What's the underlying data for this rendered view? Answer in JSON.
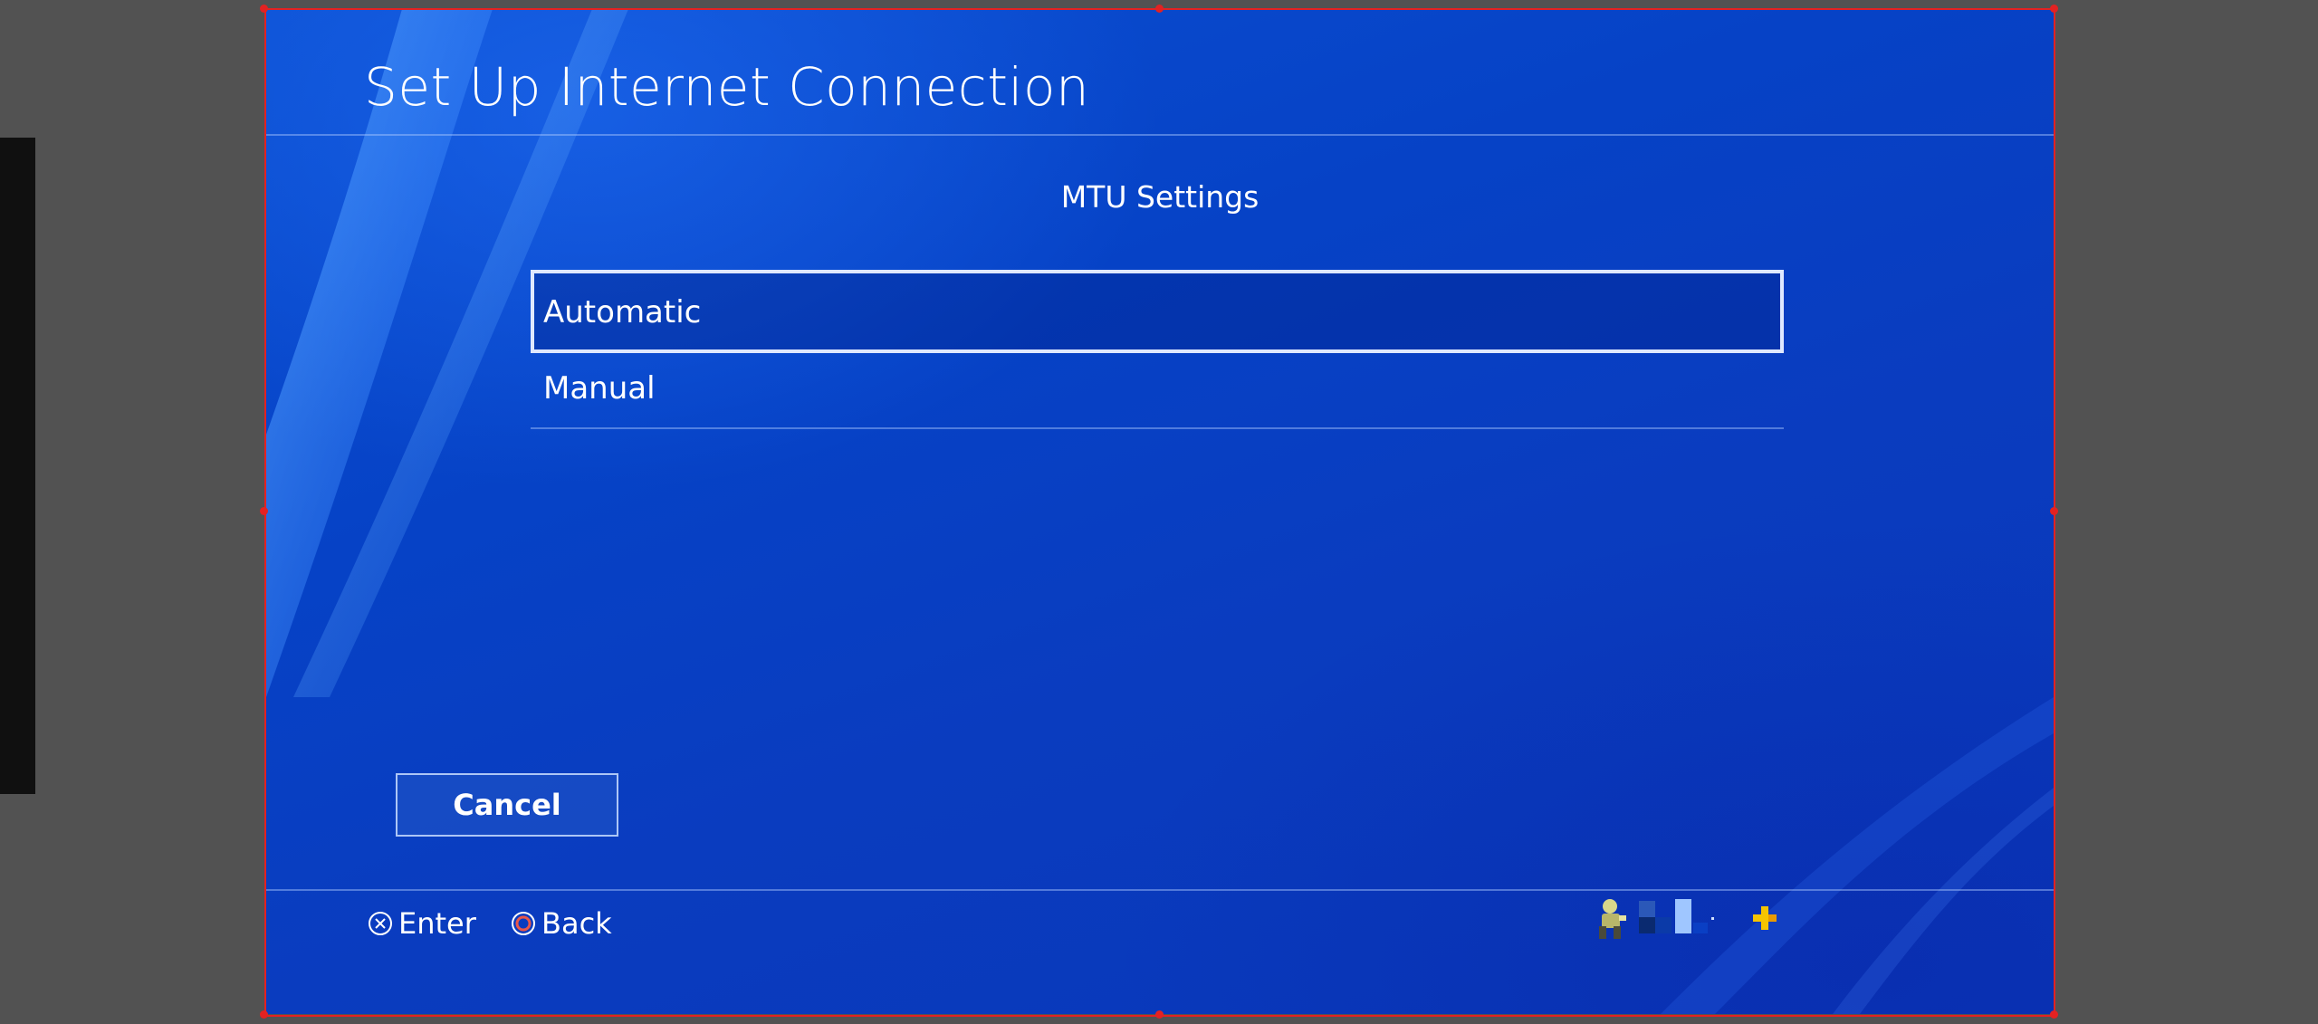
{
  "window": {
    "title": "Set Up Internet Connection"
  },
  "dialog": {
    "subtitle": "MTU Settings",
    "options": [
      {
        "label": "Automatic",
        "selected": true
      },
      {
        "label": "Manual",
        "selected": false
      }
    ],
    "cancel_label": "Cancel"
  },
  "footer": {
    "hints": [
      {
        "icon": "cross-button-icon",
        "label": "Enter"
      },
      {
        "icon": "circle-button-icon",
        "label": "Back"
      }
    ],
    "status_icons": [
      "user-avatar-icon",
      "signal-strength-icon",
      "playstation-plus-icon"
    ]
  },
  "colors": {
    "background_blue": "#0642c6",
    "highlight_border": "#dfe8ff",
    "selection_frame": "#e32222",
    "circle_button": "#e8574a",
    "ps_plus": "#f5c400"
  }
}
